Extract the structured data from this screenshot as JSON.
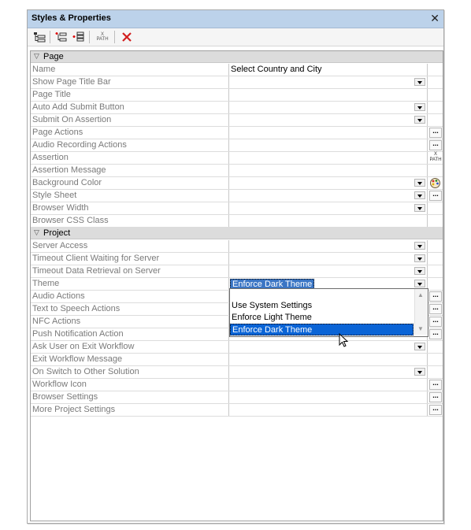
{
  "window": {
    "title": "Styles & Properties",
    "close_label": "✕"
  },
  "toolbar": {
    "items": [
      {
        "name": "tree-view-icon"
      },
      {
        "name": "add-child-icon"
      },
      {
        "name": "add-sibling-icon"
      },
      {
        "name": "xpath-icon",
        "label": "PATH"
      },
      {
        "name": "delete-icon"
      }
    ]
  },
  "categories": {
    "page": "Page",
    "project": "Project"
  },
  "page_props": [
    {
      "name": "Name",
      "value": "Select Country and City",
      "editor": "text"
    },
    {
      "name": "Show Page Title Bar",
      "value": "",
      "editor": "dropdown"
    },
    {
      "name": "Page Title",
      "value": "",
      "editor": "text"
    },
    {
      "name": "Auto Add Submit Button",
      "value": "",
      "editor": "dropdown"
    },
    {
      "name": "Submit On Assertion",
      "value": "",
      "editor": "dropdown"
    },
    {
      "name": "Page Actions",
      "value": "",
      "editor": "ellipsis"
    },
    {
      "name": "Audio Recording Actions",
      "value": "",
      "editor": "ellipsis"
    },
    {
      "name": "Assertion",
      "value": "",
      "editor": "xpath"
    },
    {
      "name": "Assertion Message",
      "value": "",
      "editor": "text"
    },
    {
      "name": "Background Color",
      "value": "",
      "editor": "dropdown-color"
    },
    {
      "name": "Style Sheet",
      "value": "",
      "editor": "dropdown-ellipsis"
    },
    {
      "name": "Browser Width",
      "value": "",
      "editor": "dropdown"
    },
    {
      "name": "Browser CSS Class",
      "value": "",
      "editor": "text"
    }
  ],
  "project_props": [
    {
      "name": "Server Access",
      "value": "",
      "editor": "dropdown"
    },
    {
      "name": "Timeout Client Waiting for Server",
      "value": "",
      "editor": "dropdown"
    },
    {
      "name": "Timeout Data Retrieval on Server",
      "value": "",
      "editor": "dropdown"
    },
    {
      "name": "Theme",
      "value": "Enforce Dark Theme",
      "editor": "dropdown"
    },
    {
      "name": "Audio Actions",
      "value": "",
      "editor": "ellipsis"
    },
    {
      "name": "Text to Speech Actions",
      "value": "",
      "editor": "ellipsis"
    },
    {
      "name": "NFC Actions",
      "value": "",
      "editor": "ellipsis"
    },
    {
      "name": "Push Notification Action",
      "value": "",
      "editor": "ellipsis"
    },
    {
      "name": "Ask User on Exit Workflow",
      "value": "",
      "editor": "dropdown"
    },
    {
      "name": "Exit Workflow Message",
      "value": "",
      "editor": "text"
    },
    {
      "name": "On Switch to Other Solution",
      "value": "",
      "editor": "dropdown"
    },
    {
      "name": "Workflow Icon",
      "value": "",
      "editor": "ellipsis"
    },
    {
      "name": "Browser Settings",
      "value": "",
      "editor": "ellipsis"
    },
    {
      "name": "More Project Settings",
      "value": "",
      "editor": "ellipsis"
    }
  ],
  "theme_dropdown": {
    "options": [
      "Use System Settings",
      "Enforce Light Theme",
      "Enforce Dark Theme"
    ],
    "highlighted": "Enforce Dark Theme"
  },
  "ellipsis_label": "...",
  "xpath_label": {
    "top": "X",
    "bottom": "PATH"
  }
}
